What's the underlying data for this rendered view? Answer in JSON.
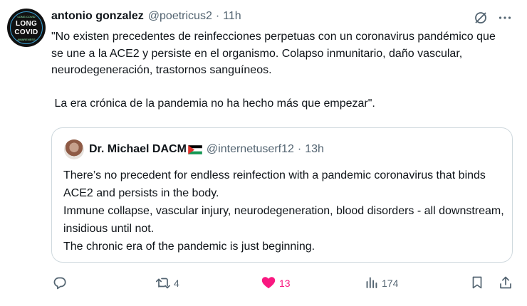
{
  "tweet": {
    "author_name": "antonio gonzalez",
    "author_handle": "@poetricus2",
    "separator": "·",
    "time": "11h",
    "text": "\"No existen precedentes de reinfecciones perpetuas con un coronavirus pandémico que se une a la ACE2 y persiste en el organismo. Colapso inmunitario, daño vascular, neurodegeneración, trastornos sanguíneos.\n\n La era crónica de la pandemia no ha hecho más que empezar\".",
    "avatar_text_1": "LONG",
    "avatar_text_2": "COVID",
    "avatar_small_top": "LONG COVID",
    "avatar_small_bottom": "AWARENESS"
  },
  "quote": {
    "author_name": "Dr. Michael DACM",
    "author_handle": "@internetuserf12",
    "separator": "·",
    "time": "13h",
    "text": "There’s no precedent for endless reinfection with a pandemic coronavirus that binds ACE2 and persists in the body.\nImmune collapse, vascular injury, neurodegeneration, blood disorders - all downstream, insidious until not.\nThe chronic era of the pandemic is just beginning."
  },
  "actions": {
    "reply_count": "",
    "retweet_count": "4",
    "like_count": "13",
    "views_count": "174"
  },
  "icons": {
    "top": [
      "grok-icon",
      "more-icon"
    ],
    "actions": [
      "reply-icon",
      "retweet-icon",
      "like-icon",
      "views-icon",
      "bookmark-icon",
      "share-icon"
    ]
  },
  "colors": {
    "text": "#0f1419",
    "secondary": "#536471",
    "like": "#f91880",
    "border": "#cfd9de"
  }
}
